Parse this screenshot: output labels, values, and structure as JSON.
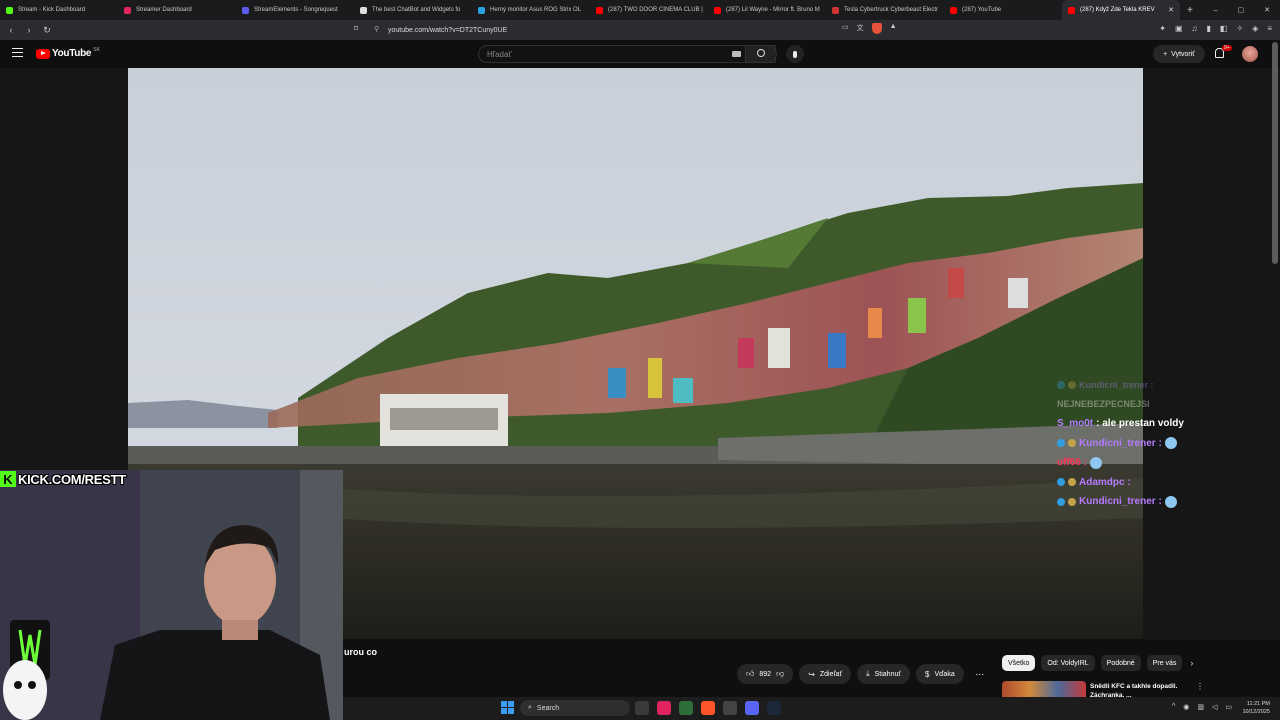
{
  "browser": {
    "tabs": [
      {
        "label": "Stream - Kick Dashboard",
        "color": "#53fc18",
        "active": false
      },
      {
        "label": "Streamer Dashboard",
        "color": "#e0245e",
        "active": false
      },
      {
        "label": "StreamElements - Songrequest",
        "color": "#5a5cf0",
        "active": false
      },
      {
        "label": "The best ChatBot and Widgets fo",
        "color": "#dddddd",
        "active": false
      },
      {
        "label": "Herný monitor Asus ROG Strix OL",
        "color": "#2aa1e0",
        "active": false
      },
      {
        "label": "(287) TWO DOOR CINEMA CLUB |",
        "color": "#ff0000",
        "active": false
      },
      {
        "label": "(287) Lil Wayne - Mirror ft. Bruno M",
        "color": "#ff0000",
        "active": false
      },
      {
        "label": "Tesla Cybertruck Cyberbeast Electr",
        "color": "#cc3333",
        "active": false
      },
      {
        "label": "(287) YouTube",
        "color": "#ff0000",
        "active": false
      },
      {
        "label": "(287) Když Zde Tekla KREV",
        "color": "#ff0000",
        "active": true
      }
    ],
    "new_tab": "+",
    "window_controls": [
      "–",
      "▢",
      "✕"
    ],
    "url": "youtube.com/watch?v=DT2TCuny0UE",
    "shield_badge": "18"
  },
  "youtube": {
    "logo": "YouTube",
    "country": "SK",
    "search_placeholder": "Hľadať",
    "create_label": "Vytvoriť",
    "notif_badge": "9+"
  },
  "overlay": {
    "kick_text": "KICK.COM/RESTT",
    "kick_letter": "K"
  },
  "chat": [
    {
      "nick": "Kundicni_trener :",
      "msg": "",
      "faded": true,
      "color": "purple",
      "badges": true,
      "emote": false
    },
    {
      "nick": "",
      "msg": "NEJNEBEZPECNEJSI",
      "faded": true,
      "color": "purple",
      "badges": false,
      "emote": false
    },
    {
      "nick": "S_mo0t",
      "msg": ": ale prestan voldy",
      "faded": false,
      "color": "purple",
      "badges": false,
      "emote": false
    },
    {
      "nick": "Kundicni_trener :",
      "msg": "",
      "faded": false,
      "color": "purple",
      "badges": true,
      "emote": true
    },
    {
      "nick": "uff66 :",
      "msg": "",
      "faded": false,
      "color": "red",
      "badges": false,
      "emote": true
    },
    {
      "nick": "Adamdpc :",
      "msg": "",
      "faded": false,
      "color": "purple",
      "badges": true,
      "emote": false
    },
    {
      "nick": "Kundicni_trener :",
      "msg": "",
      "faded": false,
      "color": "purple",
      "badges": true,
      "emote": true
    }
  ],
  "video": {
    "title_fragment": "urou co",
    "likes": "892",
    "share": "Zdieľať",
    "download": "Stiahnuť",
    "thanks": "Vďaka",
    "more": "⋯"
  },
  "chips": [
    "Všetko",
    "Od: VoldyIRL",
    "Podobné",
    "Pre vás"
  ],
  "recommendation": {
    "title": "Snědli KFC a takhle dopadli. Záchranka, ..."
  },
  "taskbar": {
    "search": "Search",
    "time": "11:21 PM",
    "date": "10/12/2025"
  },
  "colors": {
    "accent_red": "#ff0000",
    "kick_green": "#53fc18",
    "chat_purple": "#b57bff",
    "chat_red": "#ff3355"
  }
}
